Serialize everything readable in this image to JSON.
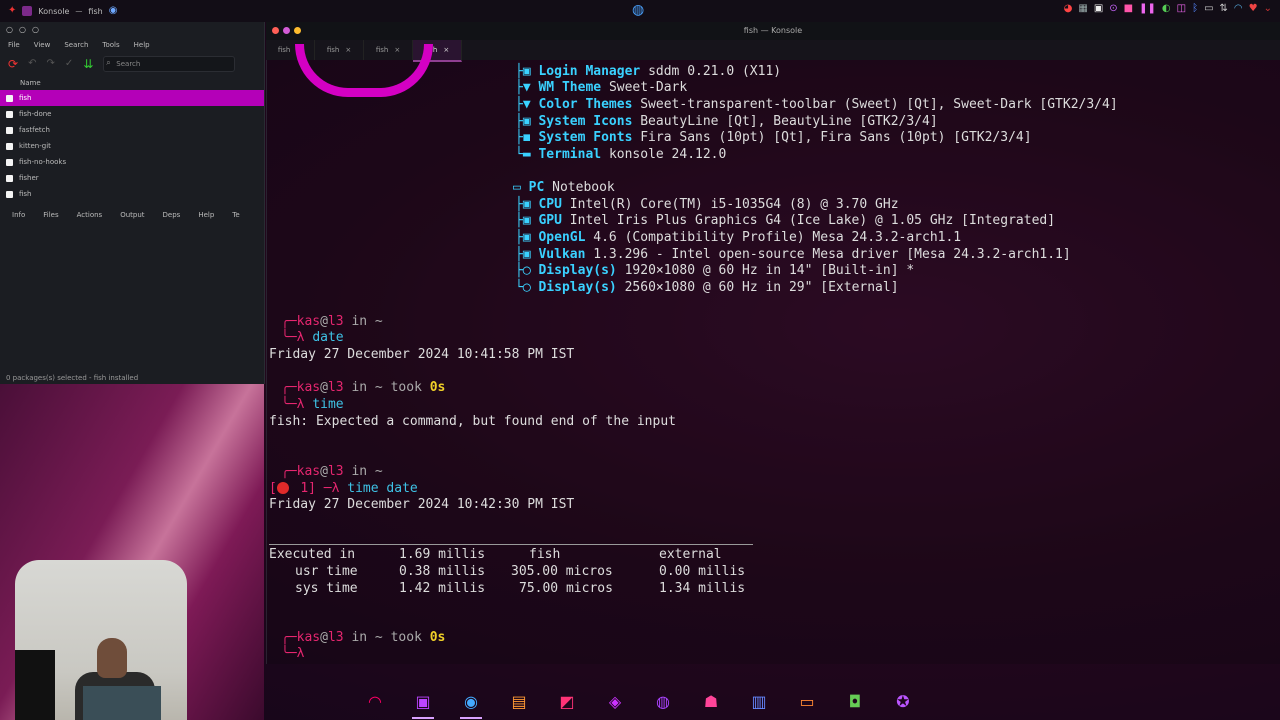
{
  "top_panel": {
    "app_name": "Konsole",
    "window_title": "fish",
    "tray_icons": [
      "chrome-icon",
      "discord-icon",
      "terminal-icon",
      "screen-icon",
      "music-icon",
      "pause-icon",
      "play-icon",
      "volume-icon",
      "battery-icon",
      "wifi-icon",
      "bluetooth-icon",
      "network-icon"
    ]
  },
  "package_manager": {
    "menu": [
      "File",
      "View",
      "Search",
      "Tools",
      "Help"
    ],
    "search_placeholder": "Search",
    "list_header": "Name",
    "rows": [
      {
        "label": "fish",
        "selected": true
      },
      {
        "label": "fish-done",
        "selected": false
      },
      {
        "label": "fastfetch",
        "selected": false
      },
      {
        "label": "kitten-git",
        "selected": false
      },
      {
        "label": "fish-no-hooks",
        "selected": false
      },
      {
        "label": "fisher",
        "selected": false
      },
      {
        "label": "fish",
        "selected": false
      }
    ],
    "tabs": [
      "Info",
      "Files",
      "Actions",
      "Output",
      "Deps",
      "Help",
      "Te"
    ],
    "status": "0 packages(s) selected - fish installed"
  },
  "terminal": {
    "title": "fish — Konsole",
    "tabs": [
      {
        "label": "fish",
        "active": false
      },
      {
        "label": "fish",
        "active": false
      },
      {
        "label": "fish",
        "active": false
      },
      {
        "label": "fish",
        "active": true
      }
    ],
    "sysinfo_top": [
      {
        "label": "Login Manager",
        "value": "sddm 0.21.0 (X11)"
      },
      {
        "label": "WM Theme",
        "value": "Sweet-Dark"
      },
      {
        "label": "Color Themes",
        "value": "Sweet-transparent-toolbar (Sweet) [Qt], Sweet-Dark [GTK2/3/4]"
      },
      {
        "label": "System Icons",
        "value": "BeautyLine [Qt], BeautyLine [GTK2/3/4]"
      },
      {
        "label": "System Fonts",
        "value": "Fira Sans (10pt) [Qt], Fira Sans (10pt) [GTK2/3/4]"
      },
      {
        "label": "Terminal",
        "value": "konsole 24.12.0"
      }
    ],
    "pc_label": "PC",
    "pc_value": "Notebook",
    "sysinfo_hw": [
      {
        "label": "CPU",
        "value": "Intel(R) Core(TM) i5-1035G4 (8) @ 3.70 GHz"
      },
      {
        "label": "GPU",
        "value": "Intel Iris Plus Graphics G4 (Ice Lake) @ 1.05 GHz [Integrated]"
      },
      {
        "label": "OpenGL",
        "value": "4.6 (Compatibility Profile) Mesa 24.3.2-arch1.1"
      },
      {
        "label": "Vulkan",
        "value": "1.3.296 - Intel open-source Mesa driver [Mesa 24.3.2-arch1.1]"
      },
      {
        "label": "Display(s)",
        "value": "1920×1080 @ 60 Hz in 14\" [Built-in] *"
      },
      {
        "label": "Display(s)",
        "value": "2560×1080 @ 60 Hz in 29\" [External]"
      }
    ],
    "prompt_user": "kas",
    "prompt_host": "l3",
    "prompt_in": "in ~",
    "prompt_in_took": "in ~ took",
    "took_value": "0s",
    "cmd1": "date",
    "out1": "Friday 27 December 2024 10:41:58 PM IST",
    "cmd2": "time",
    "out2": "fish: Expected a command, but found end of the input",
    "err_code": "1",
    "cmd3": "time date",
    "out3": "Friday 27 December 2024 10:42:30 PM IST",
    "time_header": [
      "Executed in",
      "1.69 millis",
      "fish",
      "external"
    ],
    "time_rows": [
      [
        "usr time",
        "0.38 millis",
        "305.00 micros",
        "0.00 millis"
      ],
      [
        "sys time",
        "1.42 millis",
        "75.00 micros",
        "1.34 millis"
      ]
    ]
  },
  "dock": {
    "items": [
      "speedometer-icon",
      "terminal-icon",
      "chrome-icon",
      "files-icon",
      "monitor-icon",
      "app-icon",
      "browser-icon",
      "music-icon",
      "editor-icon",
      "folder-icon",
      "android-icon",
      "settings-icon"
    ]
  }
}
